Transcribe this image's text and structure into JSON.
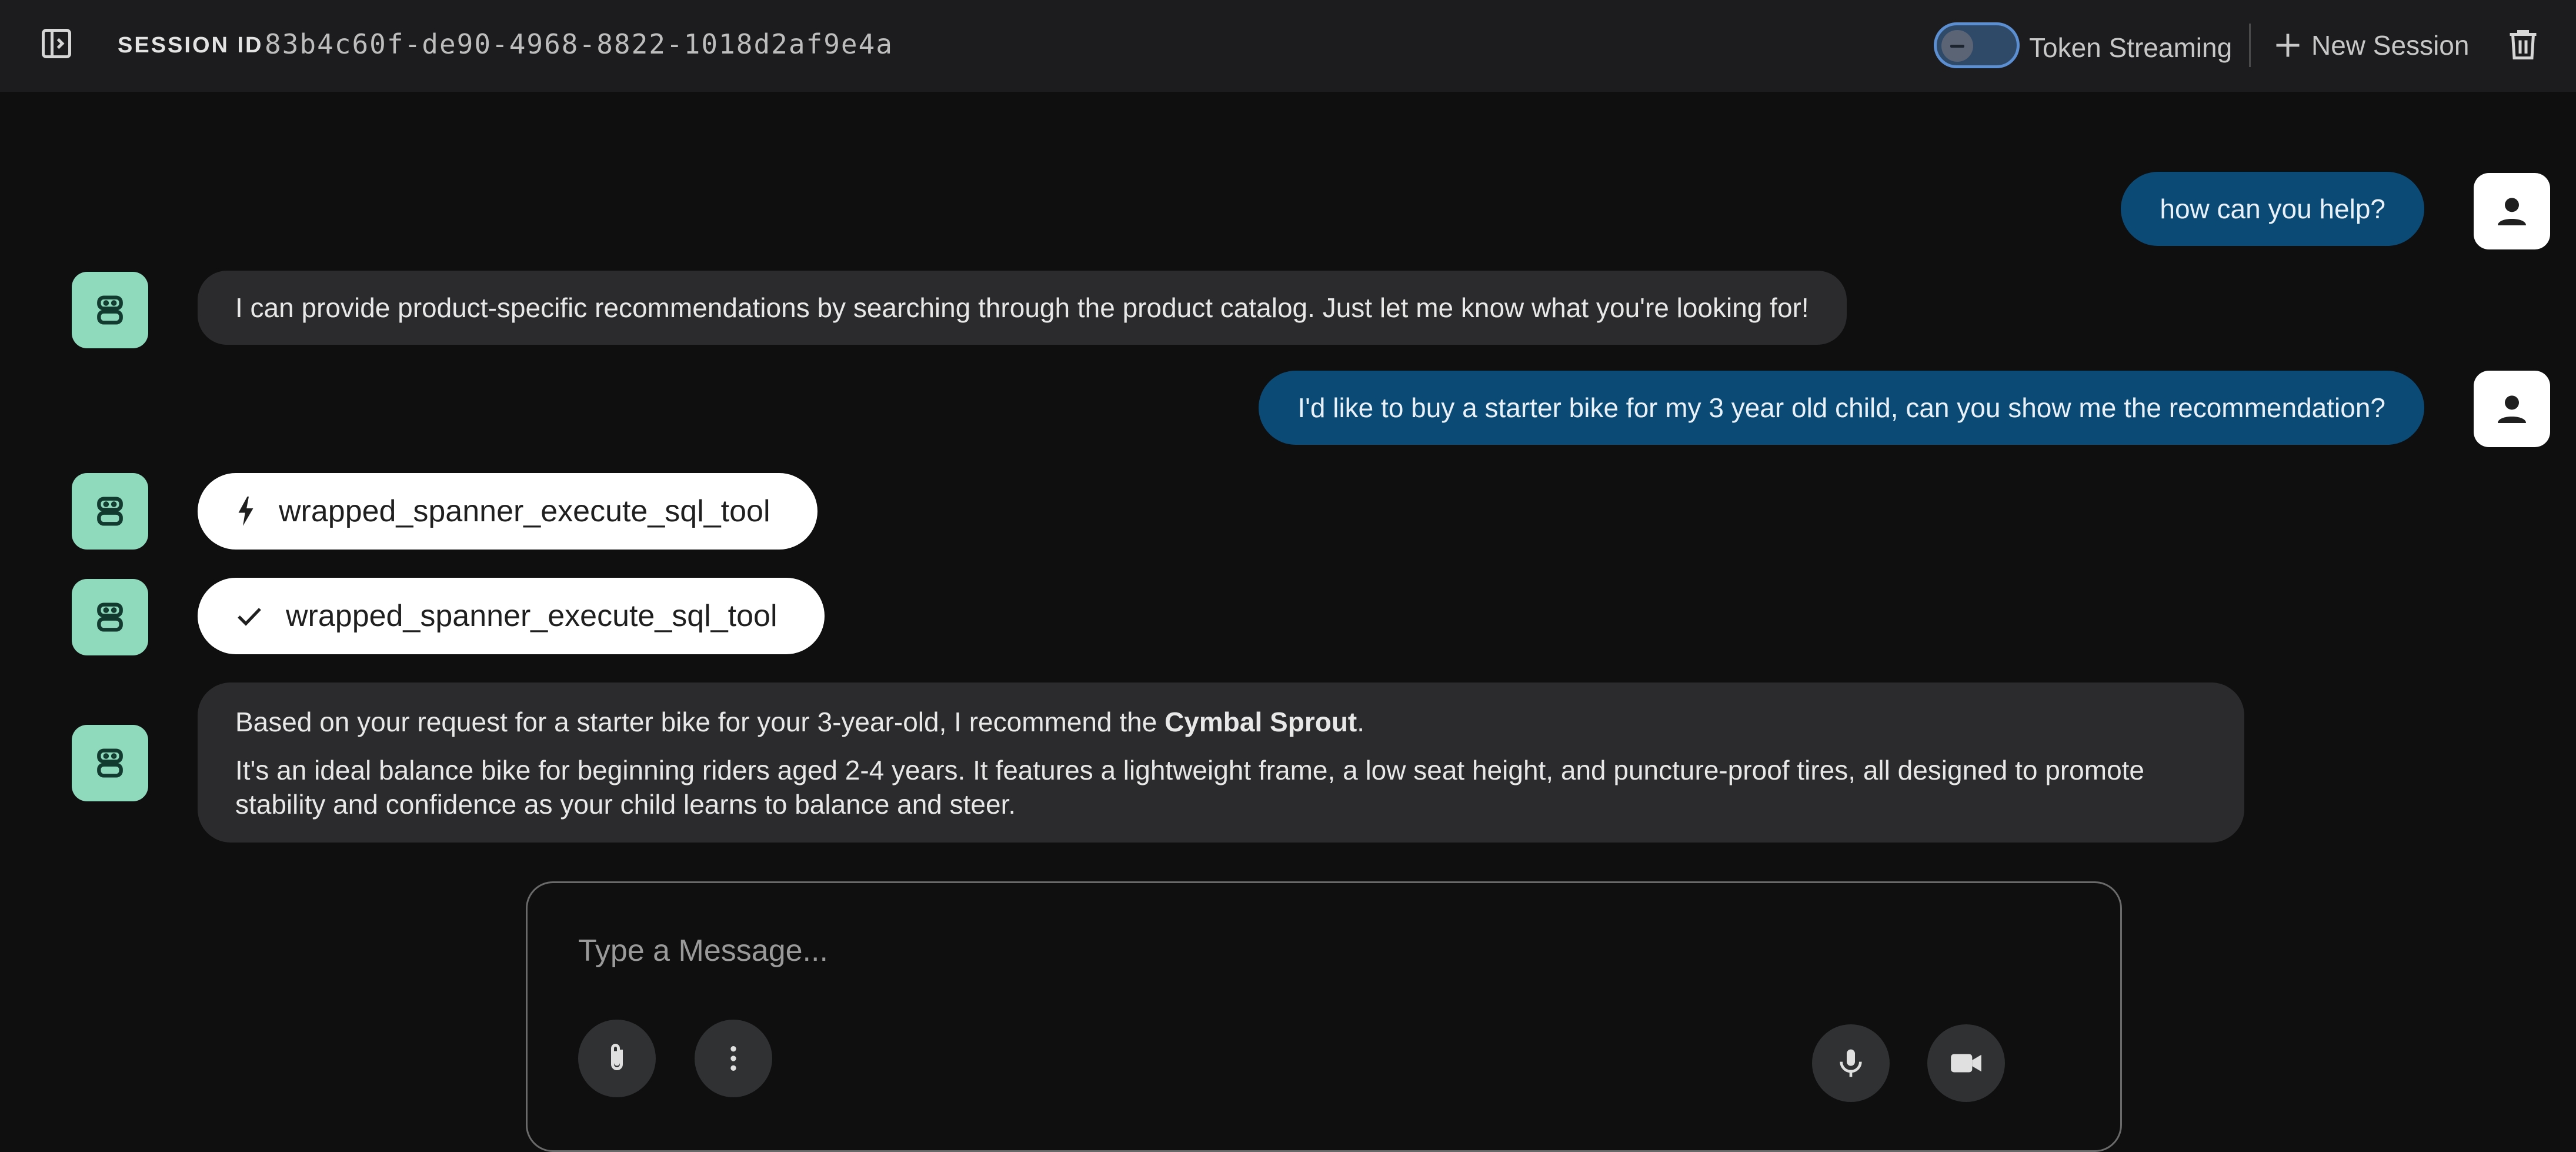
{
  "header": {
    "session_label": "SESSION ID",
    "session_id": "83b4c60f-de90-4968-8822-1018d2af9e4a",
    "token_streaming_label": "Token Streaming",
    "token_streaming_enabled": false,
    "new_session_label": "New Session"
  },
  "messages": [
    {
      "role": "user",
      "text": "how can you help?"
    },
    {
      "role": "bot",
      "text": "I can provide product-specific recommendations by searching through the product catalog. Just let me know what you're looking for!"
    },
    {
      "role": "user",
      "text": "I'd like to buy a starter bike for my 3 year old child, can you show me the recommendation?"
    },
    {
      "role": "tool_call",
      "icon": "bolt-icon",
      "text": "wrapped_spanner_execute_sql_tool"
    },
    {
      "role": "tool_result",
      "icon": "check-icon",
      "text": "wrapped_spanner_execute_sql_tool"
    },
    {
      "role": "bot",
      "p1_before": "Based on your request for a starter bike for your 3-year-old, I recommend the ",
      "p1_bold": "Cymbal Sprout",
      "p1_after": ".",
      "p2": "It's an ideal balance bike for beginning riders aged 2-4 years. It features a lightweight frame, a low seat height, and puncture-proof tires, all designed to promote stability and confidence as your child learns to balance and steer."
    }
  ],
  "composer": {
    "placeholder": "Type a Message..."
  },
  "colors": {
    "user_bubble": "#0b4a75",
    "bot_avatar": "#8fd9bd",
    "bot_bubble": "#2b2b2d"
  }
}
